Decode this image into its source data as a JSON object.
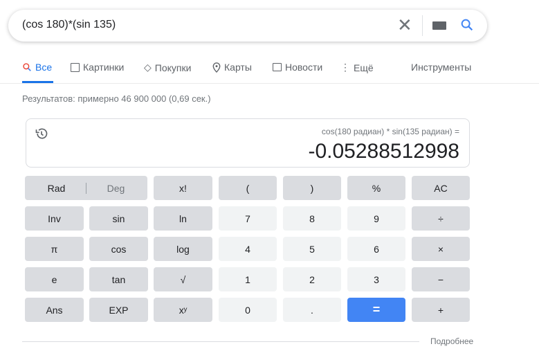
{
  "search": {
    "query": "(cos 180)*(sin 135)",
    "clear_icon": "close-icon",
    "keyboard_icon": "keyboard-icon",
    "search_icon": "search-icon"
  },
  "tabs": [
    {
      "label": "Все",
      "icon": "search-icon",
      "active": true
    },
    {
      "label": "Картинки",
      "icon": "image-icon"
    },
    {
      "label": "Покупки",
      "icon": "tag-icon"
    },
    {
      "label": "Карты",
      "icon": "map-pin-icon"
    },
    {
      "label": "Новости",
      "icon": "news-icon"
    },
    {
      "label": "Ещё",
      "icon": "more-vert-icon"
    }
  ],
  "tools_label": "Инструменты",
  "stats": "Результатов: примерно 46 900 000 (0,69 сек.)",
  "calculator": {
    "expression": "cos(180 радиан) * sin(135 радиан) =",
    "result": "-0.05288512998",
    "rad": "Rad",
    "deg": "Deg",
    "keys": [
      [
        "x!",
        "(",
        ")",
        "%",
        "AC"
      ],
      [
        "Inv",
        "sin",
        "ln",
        "7",
        "8",
        "9",
        "÷"
      ],
      [
        "π",
        "cos",
        "log",
        "4",
        "5",
        "6",
        "×"
      ],
      [
        "e",
        "tan",
        "√",
        "1",
        "2",
        "3",
        "−"
      ],
      [
        "Ans",
        "EXP",
        "xʸ",
        "0",
        ".",
        "=",
        "+"
      ]
    ],
    "more_label": "Подробнее",
    "accent": "#4285f4"
  }
}
